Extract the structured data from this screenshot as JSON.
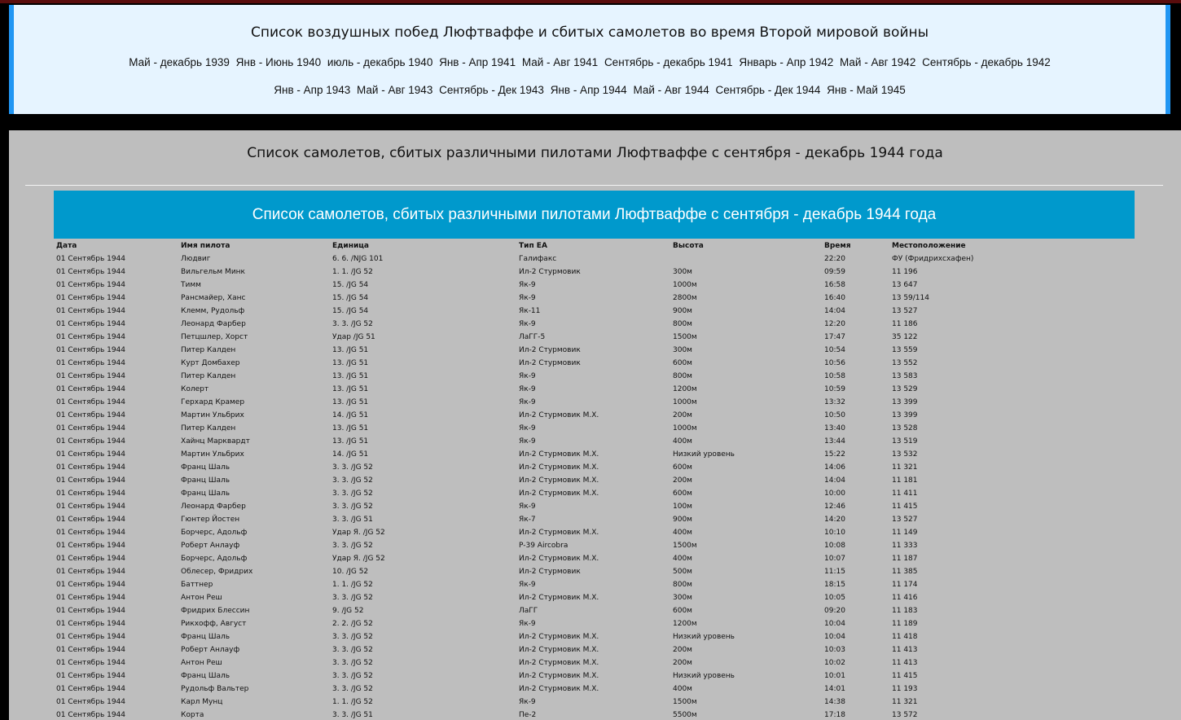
{
  "header": {
    "title": "Список воздушных побед Люфтваффе и сбитых самолетов во время Второй мировой войны",
    "nav_row1": [
      "Май - декабрь 1939",
      "Янв - Июнь 1940",
      "июль - декабрь 1940",
      "Янв - Апр 1941",
      "Май - Авг 1941",
      "Сентябрь - декабрь 1941",
      "Январь - Апр 1942",
      "Май - Авг 1942",
      "Сентябрь - декабрь 1942"
    ],
    "nav_row2": [
      "Янв - Апр 1943",
      "Май - Авг 1943",
      "Сентябрь - Дек 1943",
      "Янв - Апр 1944",
      "Май - Авг 1944",
      "Сентябрь - Дек 1944",
      "Янв - Май 1945"
    ]
  },
  "main": {
    "title": "Список самолетов, сбитых различными пилотами Люфтваффе с сентября - декабрь 1944 года",
    "banner": "Список самолетов, сбитых различными пилотами Люфтваффе с сентября - декабрь 1944 года"
  },
  "table": {
    "columns": [
      "Дата",
      "Имя пилота",
      "Единица",
      "Тип ЕА",
      "Высота",
      "Время",
      "Местоположение"
    ],
    "rows": [
      [
        "01 Сентябрь 1944",
        "Людвиг",
        "6. 6. /NJG 101",
        "Галифакс",
        "",
        "22:20",
        "ФУ (Фридрихсхафен)"
      ],
      [
        "01 Сентябрь 1944",
        "Вильгельм Минк",
        "1. 1. /JG 52",
        "Ил-2 Стурмовик",
        "300м",
        "09:59",
        "11 196"
      ],
      [
        "01 Сентябрь 1944",
        "Тимм",
        "15. /JG 54",
        "Як-9",
        "1000м",
        "16:58",
        "13 647"
      ],
      [
        "01 Сентябрь 1944",
        "Рансмайер, Ханс",
        "15. /JG 54",
        "Як-9",
        "2800м",
        "16:40",
        "13 59/114"
      ],
      [
        "01 Сентябрь 1944",
        "Клемм, Рудольф",
        "15. /JG 54",
        "Як-11",
        "900м",
        "14:04",
        "13 527"
      ],
      [
        "01 Сентябрь 1944",
        "Леонард Фарбер",
        "3. 3. /JG 52",
        "Як-9",
        "800м",
        "12:20",
        "11 186"
      ],
      [
        "01 Сентябрь 1944",
        "Петцшлер, Хорст",
        "Удар /JG 51",
        "ЛаГГ-5",
        "1500м",
        "17:47",
        "35 122"
      ],
      [
        "01 Сентябрь 1944",
        "Питер Калден",
        "13. /JG 51",
        "Ил-2 Стурмовик",
        "300м",
        "10:54",
        "13 559"
      ],
      [
        "01 Сентябрь 1944",
        "Курт Домбахер",
        "13. /JG 51",
        "Ил-2 Стурмовик",
        "600м",
        "10:56",
        "13 552"
      ],
      [
        "01 Сентябрь 1944",
        "Питер Калден",
        "13. /JG 51",
        "Як-9",
        "800м",
        "10:58",
        "13 583"
      ],
      [
        "01 Сентябрь 1944",
        "Колерт",
        "13. /JG 51",
        "Як-9",
        "1200м",
        "10:59",
        "13 529"
      ],
      [
        "01 Сентябрь 1944",
        "Герхард Крамер",
        "13. /JG 51",
        "Як-9",
        "1000м",
        "13:32",
        "13 399"
      ],
      [
        "01 Сентябрь 1944",
        "Мартин Ульбрих",
        "14. /JG 51",
        "Ил-2 Стурмовик М.Х.",
        "200м",
        "10:50",
        "13 399"
      ],
      [
        "01 Сентябрь 1944",
        "Питер Калден",
        "13. /JG 51",
        "Як-9",
        "1000м",
        "13:40",
        "13 528"
      ],
      [
        "01 Сентябрь 1944",
        "Хайнц Марквардт",
        "13. /JG 51",
        "Як-9",
        "400м",
        "13:44",
        "13 519"
      ],
      [
        "01 Сентябрь 1944",
        "Мартин Ульбрих",
        "14. /JG 51",
        "Ил-2 Стурмовик М.Х.",
        "Низкий уровень",
        "15:22",
        "13 532"
      ],
      [
        "01 Сентябрь 1944",
        "Франц Шаль",
        "3. 3. /JG 52",
        "Ил-2 Стурмовик М.Х.",
        "600м",
        "14:06",
        "11 321"
      ],
      [
        "01 Сентябрь 1944",
        "Франц Шаль",
        "3. 3. /JG 52",
        "Ил-2 Стурмовик М.Х.",
        "200м",
        "14:04",
        "11 181"
      ],
      [
        "01 Сентябрь 1944",
        "Франц Шаль",
        "3. 3. /JG 52",
        "Ил-2 Стурмовик М.Х.",
        "600м",
        "10:00",
        "11 411"
      ],
      [
        "01 Сентябрь 1944",
        "Леонард Фарбер",
        "3. 3. /JG 52",
        "Як-9",
        "100м",
        "12:46",
        "11 415"
      ],
      [
        "01 Сентябрь 1944",
        "Гюнтер Йостен",
        "3. 3. /JG 51",
        "Як-7",
        "900м",
        "14:20",
        "13 527"
      ],
      [
        "01 Сентябрь 1944",
        "Борчерс, Адольф",
        "Удар Я. /JG 52",
        "Ил-2 Стурмовик М.Х.",
        "400м",
        "10:10",
        "11 149"
      ],
      [
        "01 Сентябрь 1944",
        "Роберт Анлауф",
        "3. 3. /JG 52",
        "P-39 Aircobra",
        "1500м",
        "10:08",
        "11 333"
      ],
      [
        "01 Сентябрь 1944",
        "Борчерс, Адольф",
        "Удар Я. /JG 52",
        "Ил-2 Стурмовик М.Х.",
        "400м",
        "10:07",
        "11 187"
      ],
      [
        "01 Сентябрь 1944",
        "Облесер, Фридрих",
        "10. /JG 52",
        "Ил-2 Стурмовик",
        "500м",
        "11:15",
        "11 385"
      ],
      [
        "01 Сентябрь 1944",
        "Баттнер",
        "1. 1. /JG 52",
        "Як-9",
        "800м",
        "18:15",
        "11 174"
      ],
      [
        "01 Сентябрь 1944",
        "Антон Реш",
        "3. 3. /JG 52",
        "Ил-2 Стурмовик М.Х.",
        "300м",
        "10:05",
        "11 416"
      ],
      [
        "01 Сентябрь 1944",
        "Фридрих Блессин",
        "9. /JG 52",
        "ЛаГГ",
        "600м",
        "09:20",
        "11 183"
      ],
      [
        "01 Сентябрь 1944",
        "Рикхофф, Август",
        "2. 2. /JG 52",
        "Як-9",
        "1200м",
        "10:04",
        "11 189"
      ],
      [
        "01 Сентябрь 1944",
        "Франц Шаль",
        "3. 3. /JG 52",
        "Ил-2 Стурмовик М.Х.",
        "Низкий уровень",
        "10:04",
        "11 418"
      ],
      [
        "01 Сентябрь 1944",
        "Роберт Анлауф",
        "3. 3. /JG 52",
        "Ил-2 Стурмовик М.Х.",
        "200м",
        "10:03",
        "11 413"
      ],
      [
        "01 Сентябрь 1944",
        "Антон Реш",
        "3. 3. /JG 52",
        "Ил-2 Стурмовик М.Х.",
        "200м",
        "10:02",
        "11 413"
      ],
      [
        "01 Сентябрь 1944",
        "Франц Шаль",
        "3. 3. /JG 52",
        "Ил-2 Стурмовик М.Х.",
        "Низкий уровень",
        "10:01",
        "11 415"
      ],
      [
        "01 Сентябрь 1944",
        "Рудольф Вальтер",
        "3. 3. /JG 52",
        "Ил-2 Стурмовик М.Х.",
        "400м",
        "14:01",
        "11 193"
      ],
      [
        "01 Сентябрь 1944",
        "Карл Мунц",
        "1. 1. /JG 52",
        "Як-9",
        "1500м",
        "14:38",
        "11 321"
      ],
      [
        "01 Сентябрь 1944",
        "Корта",
        "3. 3. /JG 51",
        "Пе-2",
        "5500м",
        "17:18",
        "13 572"
      ]
    ]
  }
}
